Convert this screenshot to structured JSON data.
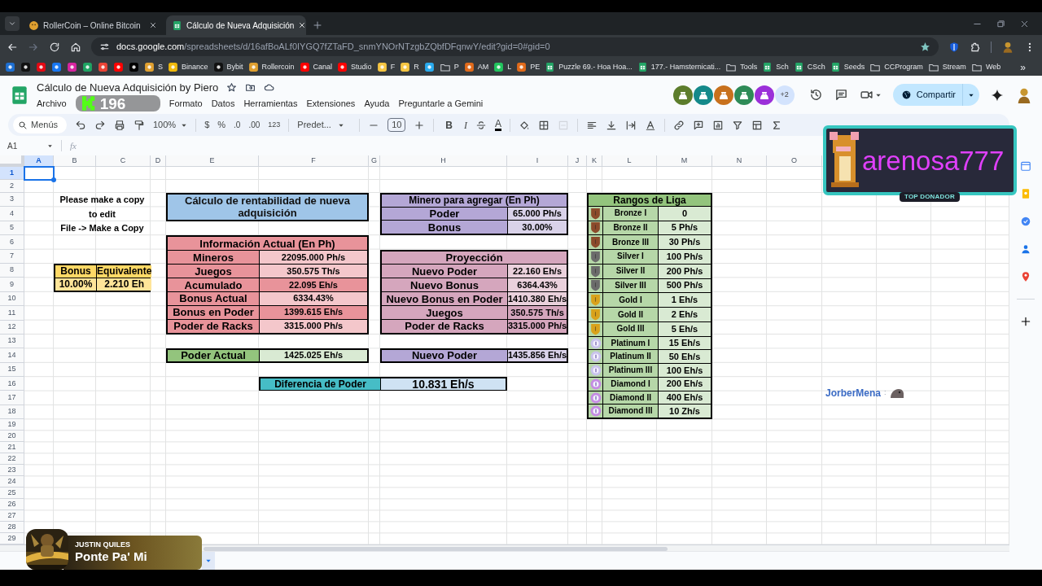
{
  "browser": {
    "tabs": [
      {
        "title": "RollerCoin – Online Bitcoin",
        "kind": "site",
        "selected": false
      },
      {
        "title": "Cálculo de Nueva Adquisición",
        "kind": "sheet",
        "selected": true
      }
    ],
    "url_host": "docs.google.com",
    "url_path": "/spreadsheets/d/16afBoALf0IYGQ7fZTaFD_snmYNOrNTzgbZQbfDFqnwY/edit?gid=0#gid=0",
    "bookmarks": [
      {
        "kind": "site",
        "color": "#1e6fd1"
      },
      {
        "kind": "site",
        "color": "#111111"
      },
      {
        "kind": "site",
        "color": "#e50914"
      },
      {
        "kind": "site",
        "color": "#1877f2"
      },
      {
        "kind": "site",
        "color": "#d6249f"
      },
      {
        "kind": "site",
        "color": "#1fa463"
      },
      {
        "kind": "site",
        "color": "#ea4335"
      },
      {
        "kind": "site",
        "color": "#ff0000"
      },
      {
        "kind": "site",
        "color": "#000000"
      },
      {
        "kind": "site",
        "color": "#e0a030",
        "label": "S"
      },
      {
        "kind": "site",
        "color": "#f0b90b",
        "label": "Binance"
      },
      {
        "kind": "site",
        "color": "#111111",
        "label": "Bybit"
      },
      {
        "kind": "site",
        "color": "#e0a030",
        "label": "Rollercoin"
      },
      {
        "kind": "site",
        "color": "#ff0000",
        "label": "Canal"
      },
      {
        "kind": "site",
        "color": "#ff0000",
        "label": "Studio"
      },
      {
        "kind": "site",
        "color": "#f5c542",
        "label": "F"
      },
      {
        "kind": "site",
        "color": "#f5c542",
        "label": "R"
      },
      {
        "kind": "site",
        "color": "#2aabee"
      },
      {
        "kind": "folder",
        "label": "P"
      },
      {
        "kind": "site",
        "color": "#e06a1b",
        "label": "AM"
      },
      {
        "kind": "site",
        "color": "#22c55e",
        "label": "L"
      },
      {
        "kind": "site",
        "color": "#e06a1b",
        "label": "PE"
      },
      {
        "kind": "sheet",
        "label": "Puzzle 69.- Hoa Hoa..."
      },
      {
        "kind": "sheet",
        "label": "177.- Hamsternicati..."
      },
      {
        "kind": "folder",
        "label": "Tools"
      },
      {
        "kind": "sheet",
        "label": "Sch"
      },
      {
        "kind": "sheet",
        "label": "CSch"
      },
      {
        "kind": "sheet",
        "label": "Seeds"
      },
      {
        "kind": "folder",
        "label": "CCProgram"
      },
      {
        "kind": "folder",
        "label": "Stream"
      },
      {
        "kind": "folder",
        "label": "Web"
      }
    ],
    "more_bookmarks": "»"
  },
  "stream_badge": {
    "count": "196"
  },
  "doc": {
    "title": "Cálculo de Nueva Adquisición by Piero",
    "menus": [
      "Archivo",
      "Formato",
      "Datos",
      "Herramientas",
      "Extensiones",
      "Ayuda",
      "Preguntarle a Gemini"
    ],
    "collaborators": [
      {
        "color": "#5d7d2c"
      },
      {
        "color": "#14898a"
      },
      {
        "color": "#c8711d"
      },
      {
        "color": "#2e8b57"
      },
      {
        "color": "#9b30d9"
      }
    ],
    "more_collaborators": "+2",
    "share": "Compartir"
  },
  "toolbar": {
    "search": "Menús",
    "zoom": "100%",
    "currency": "$",
    "percent": "%",
    "decimal_less": ".0",
    "decimal_more": ".00",
    "number_format": "123",
    "font": "Predet...",
    "font_size": "10",
    "bold": "B",
    "italic": "I",
    "text_color": "A"
  },
  "formula_bar": {
    "cell": "A1",
    "fx": "fx"
  },
  "sheet": {
    "columns": [
      {
        "label": "A",
        "selected": true
      },
      {
        "label": "B",
        "selected": false
      },
      {
        "label": "C",
        "selected": false
      },
      {
        "label": "D",
        "selected": false
      },
      {
        "label": "E",
        "selected": false
      },
      {
        "label": "F",
        "selected": false
      },
      {
        "label": "G",
        "selected": false
      },
      {
        "label": "H",
        "selected": false
      },
      {
        "label": "I",
        "selected": false
      },
      {
        "label": "J",
        "selected": false
      },
      {
        "label": "K",
        "selected": false
      },
      {
        "label": "L",
        "selected": false
      },
      {
        "label": "M",
        "selected": false
      },
      {
        "label": "N",
        "selected": false
      },
      {
        "label": "O",
        "selected": false
      }
    ],
    "rows": [
      {
        "label": "1",
        "selected": true
      },
      {
        "label": "2",
        "selected": false
      },
      {
        "label": "3",
        "selected": false
      },
      {
        "label": "4",
        "selected": false
      },
      {
        "label": "5",
        "selected": false
      },
      {
        "label": "6",
        "selected": false
      },
      {
        "label": "7",
        "selected": false
      },
      {
        "label": "8",
        "selected": false
      },
      {
        "label": "9",
        "selected": false
      },
      {
        "label": "10",
        "selected": false
      },
      {
        "label": "11",
        "selected": false
      },
      {
        "label": "12",
        "selected": false
      },
      {
        "label": "13",
        "selected": false
      },
      {
        "label": "14",
        "selected": false
      },
      {
        "label": "15",
        "selected": false
      },
      {
        "label": "16",
        "selected": false
      },
      {
        "label": "17",
        "selected": false
      },
      {
        "label": "18",
        "selected": false
      },
      {
        "label": "19",
        "selected": false
      },
      {
        "label": "20",
        "selected": false
      },
      {
        "label": "21",
        "selected": false
      },
      {
        "label": "22",
        "selected": false
      },
      {
        "label": "23",
        "selected": false
      },
      {
        "label": "24",
        "selected": false
      },
      {
        "label": "25",
        "selected": false
      },
      {
        "label": "26",
        "selected": false
      },
      {
        "label": "27",
        "selected": false
      },
      {
        "label": "28",
        "selected": false
      },
      {
        "label": "29",
        "selected": false
      }
    ],
    "notice": [
      "Please make a copy",
      "to edit",
      "File -> Make a Copy"
    ],
    "bonus_table": {
      "headers": [
        "Bonus",
        "Equivalente"
      ],
      "values": [
        "10.00%",
        "2.210 Eh"
      ]
    },
    "title_box": "Cálculo de rentabilidad de nueva adquisición",
    "info_actual": {
      "title": "Información Actual (En Ph)",
      "rows": [
        {
          "label": "Mineros",
          "value": "22095.000 Ph/s",
          "highlighted": false
        },
        {
          "label": "Juegos",
          "value": "350.575 Th/s",
          "highlighted": false
        },
        {
          "label": "Acumulado",
          "value": "22.095 Eh/s",
          "highlighted": true
        },
        {
          "label": "Bonus Actual",
          "value": "6334.43%",
          "highlighted": false
        },
        {
          "label": "Bonus en Poder",
          "value": "1399.615 Eh/s",
          "highlighted": true
        },
        {
          "label": "Poder de Racks",
          "value": "3315.000 Ph/s",
          "highlighted": false
        }
      ]
    },
    "poder_actual": {
      "label": "Poder Actual",
      "value": "1425.025 Eh/s"
    },
    "diferencia": {
      "label": "Diferencia de Poder",
      "value": "10.831 Eh/s"
    },
    "minero": {
      "title": "Minero para agregar (En Ph)",
      "rows": [
        {
          "label": "Poder",
          "value": "65.000 Ph/s"
        },
        {
          "label": "Bonus",
          "value": "30.00%"
        }
      ]
    },
    "proyeccion": {
      "title": "Proyección",
      "rows": [
        {
          "label": "Nuevo Poder",
          "value": "22.160 Eh/s",
          "highlighted": false
        },
        {
          "label": "Nuevo Bonus",
          "value": "6364.43%",
          "highlighted": false
        },
        {
          "label": "Nuevo Bonus en Poder",
          "value": "1410.380 Eh/s",
          "highlighted": false
        },
        {
          "label": "Juegos",
          "value": "350.575 Th/s",
          "highlighted": true
        },
        {
          "label": "Poder de Racks",
          "value": "3315.000 Ph/s",
          "highlighted": true
        }
      ]
    },
    "nuevo_poder": {
      "label": "Nuevo Poder",
      "value": "1435.856 Eh/s"
    },
    "rangos": {
      "title": "Rangos de Liga",
      "rows": [
        {
          "name": "Bronze I",
          "threshold": "0",
          "kind": "shield",
          "color": "#8b4a2b"
        },
        {
          "name": "Bronze II",
          "threshold": "5 Ph/s",
          "kind": "shield",
          "color": "#8b4a2b"
        },
        {
          "name": "Bronze III",
          "threshold": "30 Ph/s",
          "kind": "shield",
          "color": "#8b4a2b"
        },
        {
          "name": "Silver I",
          "threshold": "100 Ph/s",
          "kind": "shield",
          "color": "#6b6b6b"
        },
        {
          "name": "Silver II",
          "threshold": "200 Ph/s",
          "kind": "shield",
          "color": "#6b6b6b"
        },
        {
          "name": "Silver III",
          "threshold": "500 Ph/s",
          "kind": "shield",
          "color": "#6b6b6b"
        },
        {
          "name": "Gold I",
          "threshold": "1 Eh/s",
          "kind": "shield",
          "color": "#d9a21b"
        },
        {
          "name": "Gold II",
          "threshold": "2 Eh/s",
          "kind": "shield",
          "color": "#d9a21b"
        },
        {
          "name": "Gold III",
          "threshold": "5 Eh/s",
          "kind": "shield",
          "color": "#d9a21b"
        },
        {
          "name": "Platinum I",
          "threshold": "15 Eh/s",
          "kind": "medal",
          "color": "#c9c3ec"
        },
        {
          "name": "Platinum II",
          "threshold": "50 Eh/s",
          "kind": "medal",
          "color": "#c9c3ec"
        },
        {
          "name": "Platinum III",
          "threshold": "100 Eh/s",
          "kind": "medal",
          "color": "#c9c3ec"
        },
        {
          "name": "Diamond I",
          "threshold": "200 Eh/s",
          "kind": "medal",
          "color": "#c58be3"
        },
        {
          "name": "Diamond II",
          "threshold": "400 Eh/s",
          "kind": "medal",
          "color": "#c58be3"
        },
        {
          "name": "Diamond III",
          "threshold": "10 Zh/s",
          "kind": "medal",
          "color": "#c58be3"
        }
      ]
    }
  },
  "donor_banner": {
    "name": "arenosa777",
    "tag": "TOP DONADOR"
  },
  "chat": {
    "user": "JorberMena",
    "separator": ":"
  },
  "now_playing": {
    "artist": "JUSTIN QUILES",
    "title": "Ponte Pa' Mi"
  }
}
